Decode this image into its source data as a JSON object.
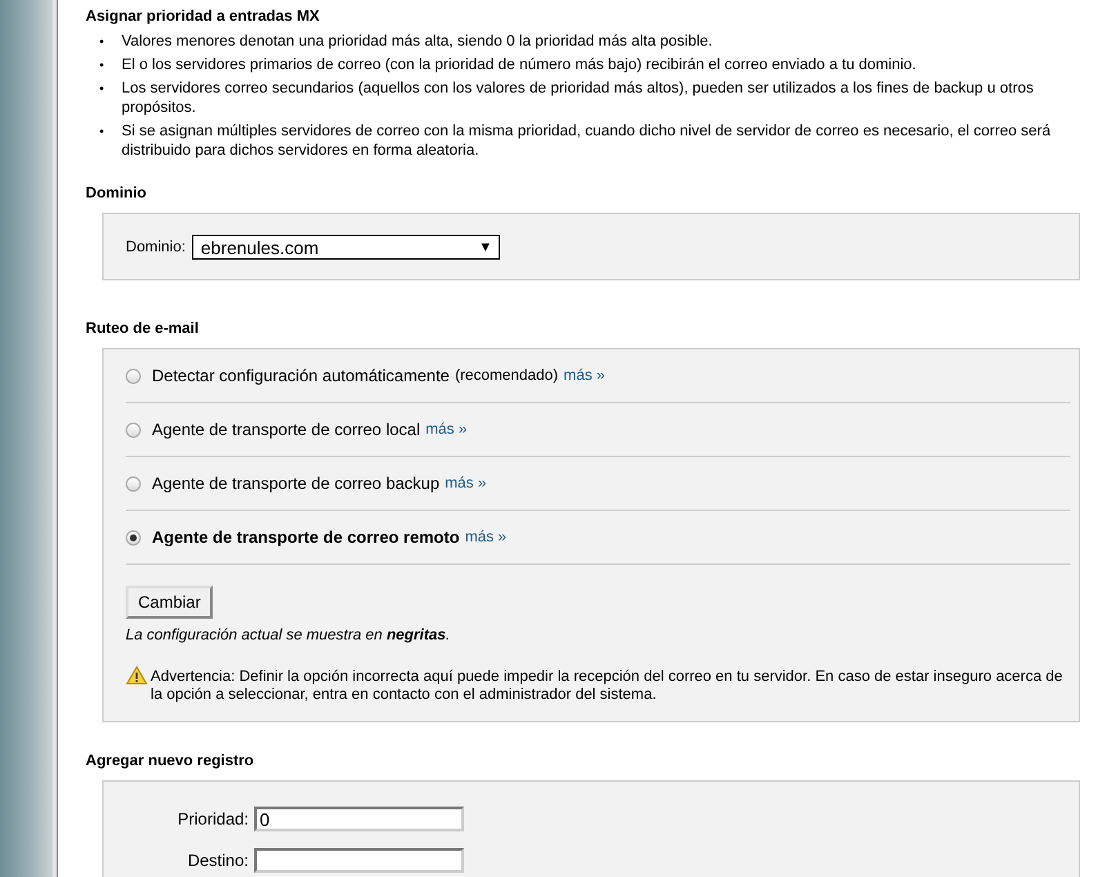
{
  "mx_priority": {
    "heading": "Asignar prioridad a entradas MX",
    "bullets": [
      {
        "marker": "•",
        "text": "Valores menores denotan una prioridad más alta, siendo 0 la prioridad más alta posible."
      },
      {
        "marker": "•",
        "text": "El o los servidores primarios de correo (con la prioridad de número más bajo) recibirán el correo enviado a tu dominio."
      },
      {
        "marker": "•",
        "text": "Los servidores correo secundarios (aquellos con los valores de prioridad más altos), pueden ser utilizados a los fines de backup u otros propósitos."
      },
      {
        "marker": "•",
        "text": "Si se asignan múltiples servidores de correo con la misma prioridad, cuando dicho nivel de servidor de correo es necesario, el correo será distribuido para dichos servidores en forma aleatoria."
      }
    ]
  },
  "domain": {
    "heading": "Dominio",
    "label": "Dominio:",
    "value": "ebrenules.com",
    "caret": "▼"
  },
  "routing": {
    "heading": "Ruteo de e-mail",
    "options": [
      {
        "label": "Detectar configuración automáticamente",
        "note": "(recomendado)",
        "link": "más »",
        "selected": false
      },
      {
        "label": "Agente de transporte de correo local",
        "link": "más »",
        "selected": false
      },
      {
        "label": "Agente de transporte de correo backup",
        "link": "más »",
        "selected": false
      },
      {
        "label": "Agente de transporte de correo remoto",
        "link": "más »",
        "selected": true
      }
    ],
    "button": "Cambiar",
    "hint": "La configuración actual se muestra en **negritas**.",
    "warning": "Advertencia: Definir la opción incorrecta aquí puede impedir la recepción del correo en tu servidor. En caso de estar inseguro acerca de la opción a seleccionar, entra en contacto con el administrador del sistema."
  },
  "new_record": {
    "heading": "Agregar nuevo registro",
    "fields": [
      {
        "label": "Prioridad:",
        "value": "0"
      },
      {
        "label": "Destino:"
      }
    ]
  }
}
